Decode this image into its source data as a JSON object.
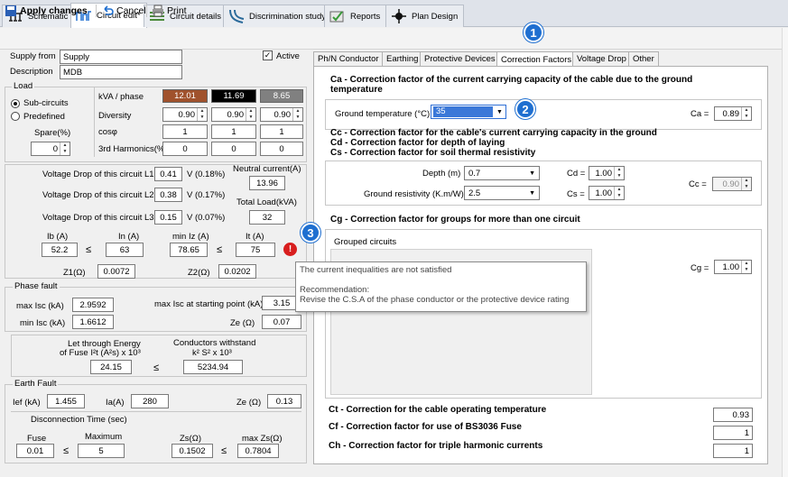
{
  "tabs": [
    {
      "label": "Schematic"
    },
    {
      "label": "Circuit edit*"
    },
    {
      "label": "Circuit details"
    },
    {
      "label": "Discrimination study"
    },
    {
      "label": "Reports"
    },
    {
      "label": "Plan Design"
    }
  ],
  "toolbar": {
    "apply": "Apply changes",
    "cancel": "Cancel",
    "print": "Print"
  },
  "left": {
    "supply_from_label": "Supply from",
    "supply_from": "Supply",
    "description_label": "Description",
    "description": "MDB",
    "active_label": "Active",
    "load": {
      "title": "Load",
      "kva_label": "kVA / phase",
      "sub_circuits": "Sub-circuits",
      "predefined": "Predefined",
      "kva": [
        "12.01",
        "11.69",
        "8.65"
      ],
      "kva_colors": [
        "#a0522d",
        "#000000",
        "#808080"
      ],
      "diversity_label": "Diversity",
      "diversity": [
        "0.90",
        "0.90",
        "0.90"
      ],
      "cos_label": "cosφ",
      "cos": [
        "1",
        "1",
        "1"
      ],
      "spare_label": "Spare(%)",
      "spare": "0",
      "harm_label": "3rd Harmonics(%)",
      "harm": [
        "0",
        "0",
        "0"
      ]
    },
    "vd": {
      "l1_label": "Voltage Drop of this circuit L1",
      "l1": "0.41",
      "l1_pct": "V (0.18%)",
      "l2_label": "Voltage Drop of this circuit L2",
      "l2": "0.38",
      "l2_pct": "V (0.17%)",
      "l3_label": "Voltage Drop of this circuit L3",
      "l3": "0.15",
      "l3_pct": "V (0.07%)",
      "neutral_label": "Neutral current(A)",
      "neutral": "13.96",
      "total_label": "Total Load(kVA)",
      "total": "32"
    },
    "currents": {
      "ib_label": "Ib (A)",
      "ib": "52.2",
      "in_label": "In (A)",
      "in": "63",
      "miniz_label": "min Iz (A)",
      "miniz": "78.65",
      "it_label": "It (A)",
      "it": "75",
      "le": "≤",
      "z1_label": "Z1(Ω)",
      "z1": "0.0072",
      "z2_label": "Z2(Ω)",
      "z2": "0.0202"
    },
    "phase_fault": {
      "title": "Phase fault",
      "maxisc_label": "max Isc (kA)",
      "maxisc": "2.9592",
      "maxstart_label": "max Isc at starting point (kA)",
      "maxstart": "3.15",
      "minisc_label": "min Isc (kA)",
      "minisc": "1.6612",
      "ze_label": "Ze (Ω)",
      "ze": "0.07"
    },
    "energy": {
      "fuse_label1": "Let through Energy",
      "fuse_label2": "of Fuse I²t (A²s) x 10³",
      "fuse": "24.15",
      "cond_label1": "Conductors withstand",
      "cond_label2": "k² S² x 10³",
      "cond": "5234.94"
    },
    "earth": {
      "title": "Earth Fault",
      "ief_label": "Ief (kA)",
      "ief": "1.455",
      "ia_label": "Ia(A)",
      "ia": "280",
      "ze_label": "Ze (Ω)",
      "ze": "0.13",
      "disc_label": "Disconnection Time (sec)",
      "fuse_label": "Fuse",
      "fuse": "0.01",
      "max_label": "Maximum",
      "max": "5",
      "zs_label": "Zs(Ω)",
      "zs": "0.1502",
      "maxzs_label": "max Zs(Ω)",
      "maxzs": "0.7804"
    }
  },
  "right": {
    "tabs": [
      {
        "label": "Ph/N Conductor"
      },
      {
        "label": "Earthing"
      },
      {
        "label": "Protective Devices"
      },
      {
        "label": "Correction Factors"
      },
      {
        "label": "Voltage Drop"
      },
      {
        "label": "Other"
      }
    ],
    "ca_title": "Ca - Correction factor of the current carrying capacity of the cable due to the ground temperature",
    "ground_temp_label": "Ground temperature (°C)",
    "ground_temp": "35",
    "ca_label": "Ca =",
    "ca": "0.89",
    "cc_title": "Cc - Correction factor for the cable's current carrying capacity in the ground",
    "cd_title": "Cd - Correction factor for depth of laying",
    "cs_title": "Cs - Correction factor for soil thermal resistivity",
    "depth_label": "Depth (m)",
    "depth": "0.7",
    "cd_label": "Cd =",
    "cd": "1.00",
    "resist_label": "Ground resistivity (K.m/W)",
    "resist": "2.5",
    "cs_label": "Cs =",
    "cs": "1.00",
    "cc_label": "Cc =",
    "cc": "0.90",
    "cg_title": "Cg - Correction factor for groups for more than one circuit",
    "grouped_label": "Grouped circuits",
    "cg_label": "Cg =",
    "cg": "1.00",
    "ct_title": "Ct - Correction for the cable operating temperature",
    "ct": "0.93",
    "cf_title": "Cf - Correction factor for use of BS3036 Fuse",
    "cf": "1",
    "ch_title": "Ch - Correction factor for triple harmonic currents",
    "ch": "1"
  },
  "tooltip": {
    "line1": "The current inequalities are not satisfied",
    "line2": "Recommendation:",
    "line3": "Revise the C.S.A of the phase conductor or the protective device rating"
  },
  "badges": [
    "1",
    "2",
    "3"
  ]
}
